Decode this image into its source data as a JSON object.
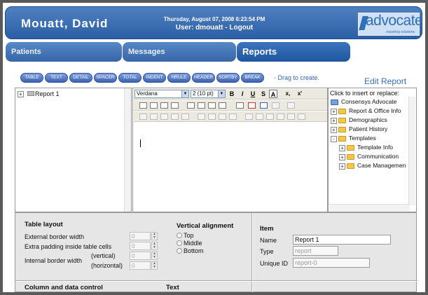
{
  "header": {
    "user_name": "Mouatt, David",
    "date": "Thursday, August 07, 2008 6:23:54 PM",
    "user_line": "User: dmouatt - Logout",
    "logo_text": "advocate",
    "logo_sub": "reporting solutions"
  },
  "tabs": [
    {
      "label": "Patients",
      "active": false
    },
    {
      "label": "Messages",
      "active": false
    },
    {
      "label": "Reports",
      "active": true
    }
  ],
  "palette": {
    "buttons": [
      "TABLE",
      "TEXT",
      "DETAIL",
      "SPACER",
      "TOTAL",
      "INDENT",
      "HRULE",
      "HEADER",
      "SORTBY",
      "BREAK"
    ],
    "hint": "- Drag to create."
  },
  "page_title": "Edit Report",
  "report_tree": {
    "root": "Report 1"
  },
  "editor": {
    "font": "Verdana",
    "size": "2 (10 pt)",
    "format_buttons": [
      "B",
      "I",
      "U",
      "S",
      "A",
      "x,",
      "x'"
    ]
  },
  "insert_panel": {
    "title": "Click to insert or replace:",
    "items": [
      {
        "label": "Consensys Advocate",
        "level": 0,
        "expander": ""
      },
      {
        "label": "Report & Office Info",
        "level": 1,
        "expander": "+"
      },
      {
        "label": "Demographics",
        "level": 1,
        "expander": "+"
      },
      {
        "label": "Patient History",
        "level": 1,
        "expander": "+"
      },
      {
        "label": "Templates",
        "level": 1,
        "expander": "-"
      },
      {
        "label": "Template Info",
        "level": 2,
        "expander": "+"
      },
      {
        "label": "Communication",
        "level": 2,
        "expander": "+"
      },
      {
        "label": "Case Managemen",
        "level": 2,
        "expander": "+"
      }
    ]
  },
  "table_layout": {
    "title": "Table layout",
    "external_border_label": "External border width",
    "extra_padding_label": "Extra padding inside table cells",
    "internal_border_label": "Internal border width",
    "vertical_label": "(vertical)",
    "horizontal_label": "(horizontal)",
    "values": {
      "external": "0",
      "padding": "0",
      "vertical": "0",
      "horizontal": "0"
    }
  },
  "vertical_alignment": {
    "title": "Vertical alignment",
    "options": [
      "Top",
      "Middle",
      "Bottom"
    ]
  },
  "item": {
    "title": "Item",
    "name_label": "Name",
    "name_value": "Report 1",
    "type_label": "Type",
    "type_value": "report",
    "uid_label": "Unique ID",
    "uid_value": "report-0"
  },
  "lower_section": {
    "column_title": "Column and data control",
    "text_title": "Text"
  }
}
